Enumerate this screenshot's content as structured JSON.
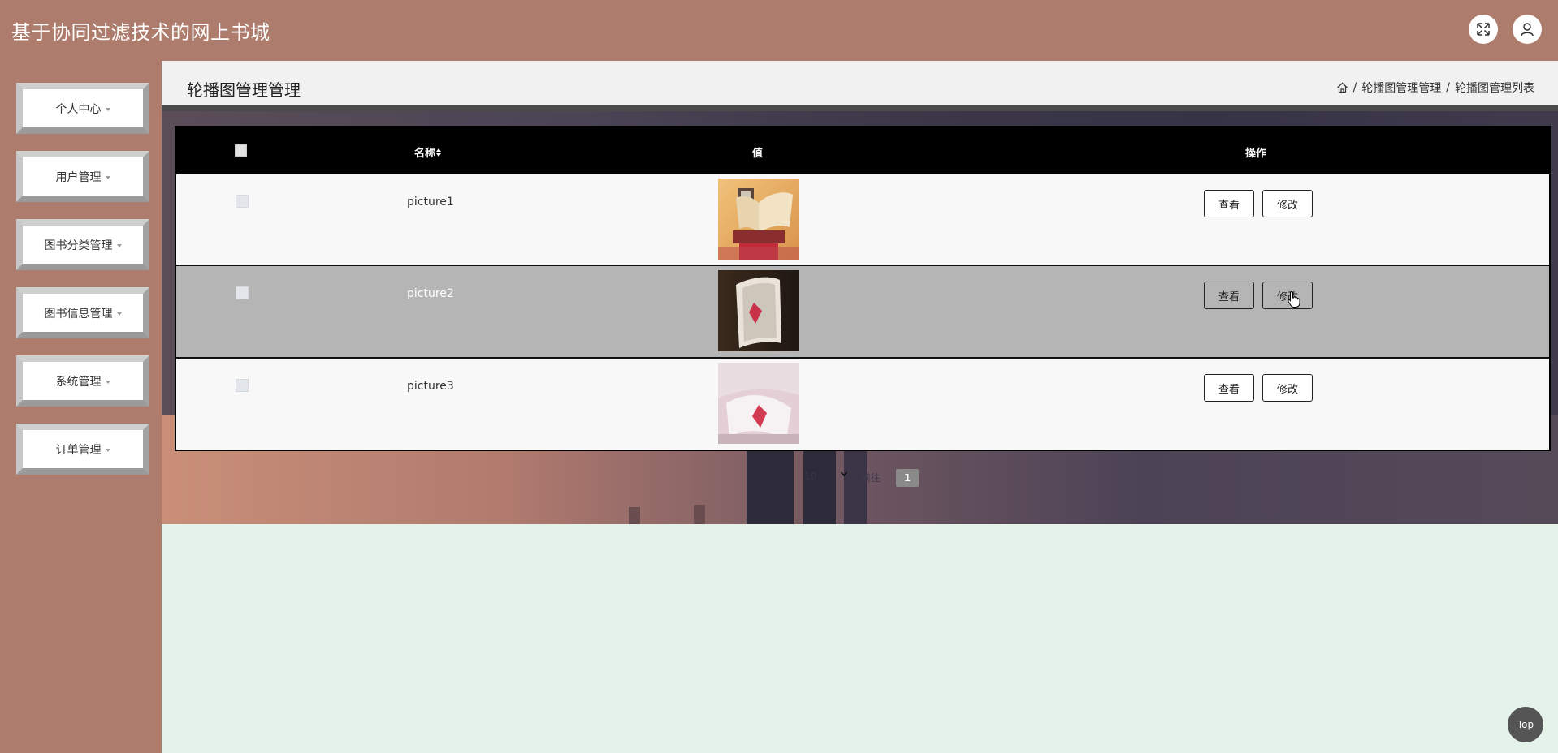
{
  "header": {
    "title": "基于协同过滤技术的网上书城",
    "fullscreen_icon": "expand-arrows-icon",
    "user_icon": "user-icon"
  },
  "sidebar": {
    "items": [
      {
        "label": "个人中心"
      },
      {
        "label": "用户管理"
      },
      {
        "label": "图书分类管理"
      },
      {
        "label": "图书信息管理"
      },
      {
        "label": "系统管理"
      },
      {
        "label": "订单管理"
      }
    ]
  },
  "page": {
    "title": "轮播图管理管理",
    "breadcrumb": {
      "home_icon": "home-icon",
      "separator": "/",
      "level1": "轮播图管理管理",
      "level2": "轮播图管理列表"
    }
  },
  "table": {
    "columns": {
      "name": "名称",
      "sort_icon": "sort-icon",
      "value": "值",
      "actions": "操作"
    },
    "rows": [
      {
        "name": "picture1",
        "image": "book-photo-1"
      },
      {
        "name": "picture2",
        "image": "book-photo-2"
      },
      {
        "name": "picture3",
        "image": "book-photo-3"
      }
    ],
    "view_label": "查看",
    "edit_label": "修改"
  },
  "pagination": {
    "page_size": "10",
    "goto_label": "前往",
    "current_page": "1"
  },
  "back_to_top": "Top",
  "colors": {
    "header_bg": "#ad7c6c",
    "content_bg": "#e5f2ea",
    "table_header_bg": "#000000",
    "row_hover_bg": "#b5b5b5"
  }
}
